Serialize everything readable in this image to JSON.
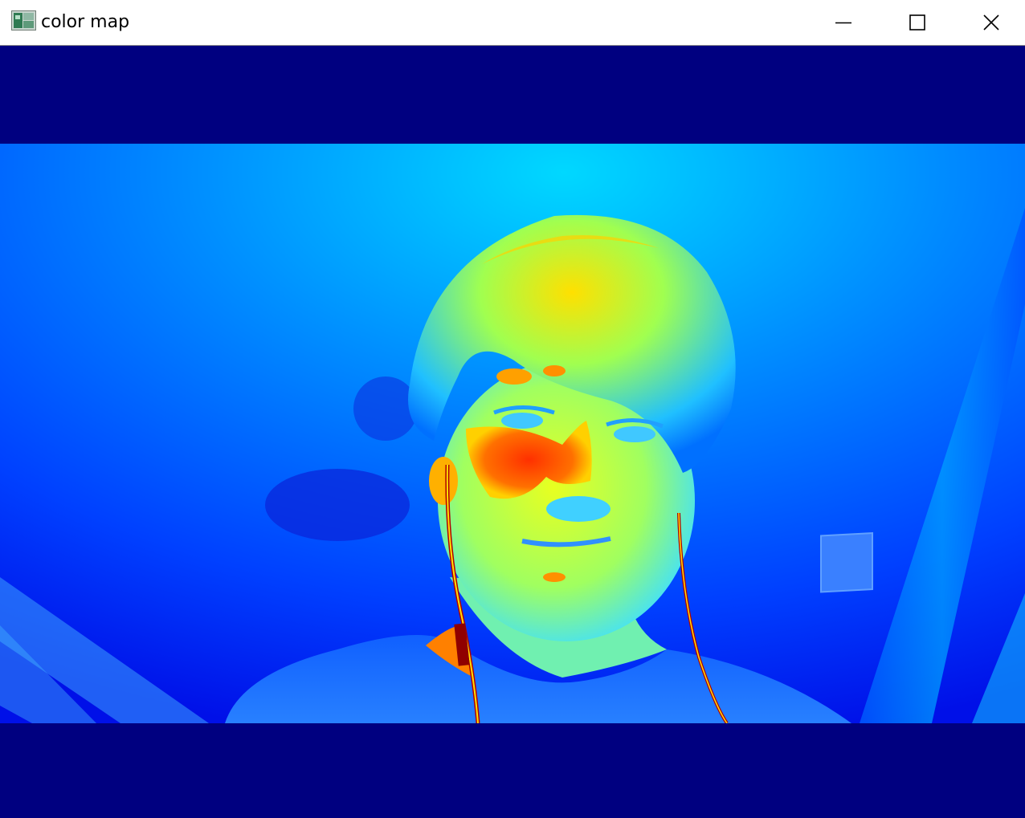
{
  "window": {
    "title": "color map",
    "icon": "opencv-window-icon",
    "controls": {
      "minimize": "minimize-icon",
      "maximize": "maximize-icon",
      "close": "close-icon"
    }
  },
  "image": {
    "description_colormap": "jet",
    "colors": {
      "letterbox": "#000080",
      "background_light": "#00c8ff",
      "background_dark": "#0018f0",
      "skin": "#c8ff40",
      "hot": "#ff4000"
    }
  }
}
